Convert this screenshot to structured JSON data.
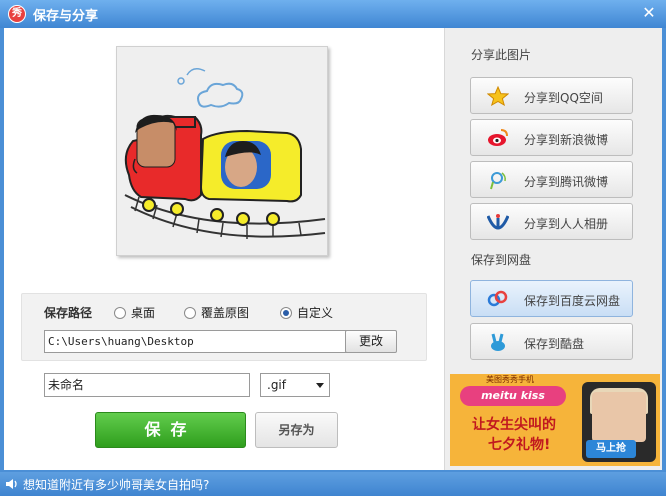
{
  "window": {
    "title": "保存与分享",
    "logo_char": "秀",
    "close_glyph": "✕"
  },
  "save_path": {
    "label": "保存路径",
    "options": [
      "桌面",
      "覆盖原图",
      "自定义"
    ],
    "selected": "自定义",
    "path_value": "C:\\Users\\huang\\Desktop",
    "change_button": "更改"
  },
  "file": {
    "name_value": "未命名",
    "format_value": ".gif"
  },
  "buttons": {
    "save": "保存",
    "save_as": "另存为"
  },
  "share": {
    "section_label": "分享此图片",
    "items": [
      {
        "label": "分享到QQ空间",
        "icon": "qzone-star-icon"
      },
      {
        "label": "分享到新浪微博",
        "icon": "sina-weibo-icon"
      },
      {
        "label": "分享到腾讯微博",
        "icon": "tencent-weibo-icon"
      },
      {
        "label": "分享到人人相册",
        "icon": "renren-icon"
      }
    ]
  },
  "cloud": {
    "section_label": "保存到网盘",
    "items": [
      {
        "label": "保存到百度云网盘",
        "icon": "baidu-cloud-icon"
      },
      {
        "label": "保存到酷盘",
        "icon": "kupan-rabbit-icon"
      }
    ]
  },
  "ad": {
    "small_text": "美图秀秀手机",
    "brand": "meitu kiss",
    "line1": "让女生尖叫的",
    "line2": "七夕礼物!",
    "cta": "马上抢"
  },
  "status": {
    "text": "想知道附近有多少帅哥美女自拍吗?"
  },
  "colors": {
    "titlebar": "#4b8fd6",
    "save_green": "#3aa828",
    "ad_orange": "#f6b43a"
  }
}
